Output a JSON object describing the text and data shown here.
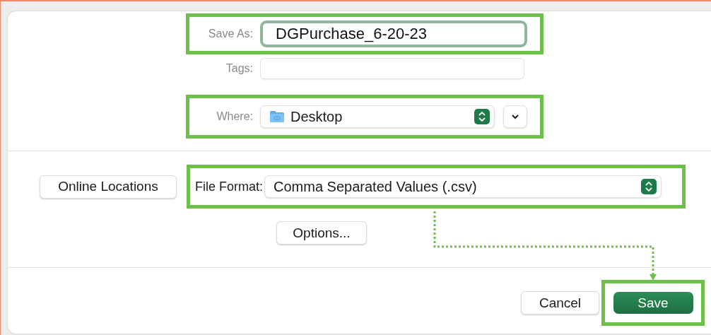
{
  "save_as": {
    "label": "Save As:",
    "value": "DGPurchase_6-20-23",
    "highlighted": true
  },
  "tags": {
    "label": "Tags:"
  },
  "where": {
    "label": "Where:",
    "value": "Desktop",
    "highlighted": true
  },
  "online_locations_button": "Online Locations",
  "file_format": {
    "label": "File Format:",
    "value": "Comma Separated Values (.csv)",
    "highlighted": true
  },
  "options_button": "Options...",
  "cancel_button": "Cancel",
  "save_button": {
    "label": "Save",
    "highlighted": true
  }
}
